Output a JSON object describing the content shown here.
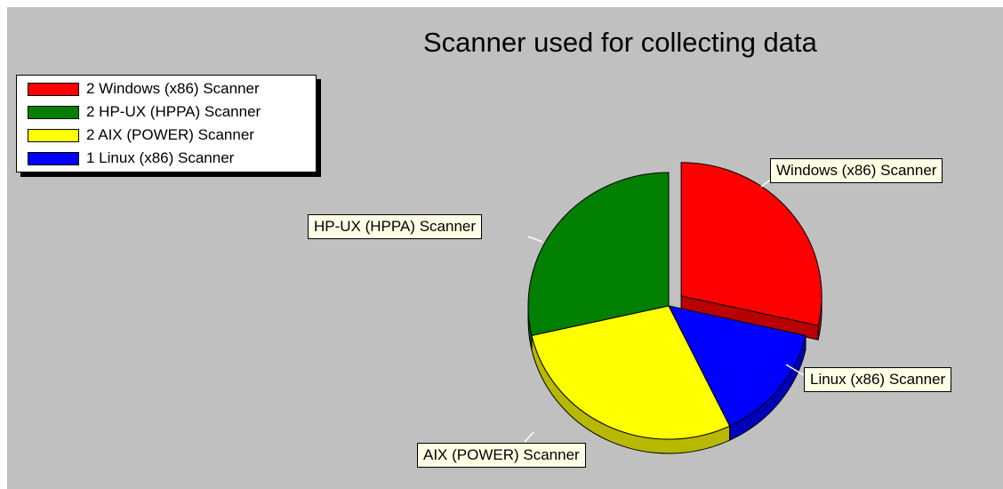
{
  "chart_data": {
    "type": "pie",
    "title": "Scanner used for collecting data",
    "slices": [
      {
        "name": "Windows (x86) Scanner",
        "legend_label": "2 Windows (x86) Scanner",
        "value": 2,
        "color": "#ff0000",
        "exploded": true
      },
      {
        "name": "Linux (x86) Scanner",
        "legend_label": "1 Linux (x86) Scanner",
        "value": 1,
        "color": "#0000ff",
        "exploded": false
      },
      {
        "name": "AIX (POWER) Scanner",
        "legend_label": "2 AIX (POWER) Scanner",
        "value": 2,
        "color": "#ffff00",
        "exploded": false
      },
      {
        "name": "HP-UX (HPPA) Scanner",
        "legend_label": "2 HP-UX (HPPA) Scanner",
        "value": 2,
        "color": "#007f00",
        "exploded": false
      }
    ],
    "legend_order": [
      0,
      3,
      2,
      1
    ],
    "legend_position": "top-left",
    "style": "3d"
  }
}
